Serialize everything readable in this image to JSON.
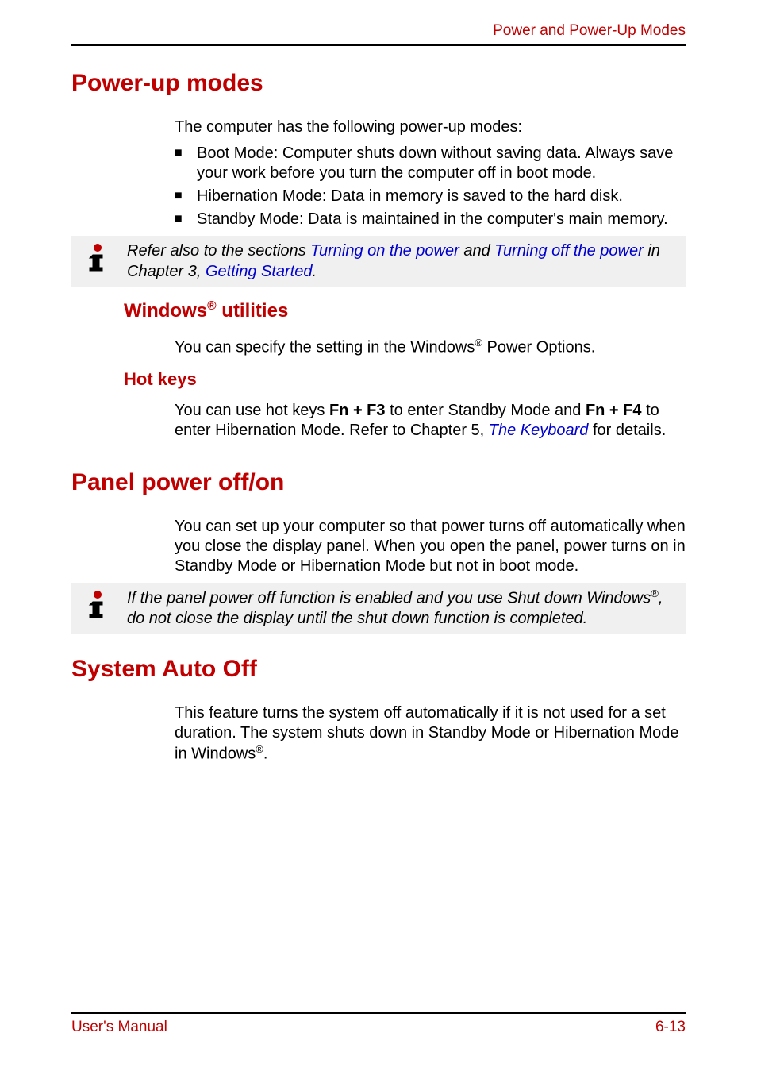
{
  "header": {
    "section_title": "Power and Power-Up Modes"
  },
  "s1": {
    "heading": "Power-up modes",
    "intro": "The computer has the following power-up modes:",
    "bullets": [
      "Boot Mode: Computer shuts down without saving data. Always save your work before you turn the computer off in boot mode.",
      "Hibernation Mode: Data in memory is saved to the hard disk.",
      "Standby Mode: Data is maintained in the computer's main memory."
    ],
    "note": {
      "pre": "Refer also to the sections ",
      "link1": "Turning on the power",
      "mid1": " and ",
      "link2": "Turning off the power",
      "mid2": " in Chapter 3, ",
      "link3": "Getting Started",
      "post": "."
    },
    "sub1": {
      "heading_pre": "Windows",
      "heading_sup": "®",
      "heading_post": " utilities",
      "body_pre": "You can specify the setting in the Windows",
      "body_sup": "®",
      "body_post": " Power Options."
    },
    "sub2": {
      "heading": "Hot keys",
      "body_pre": "You can use hot keys ",
      "key1": "Fn + F3",
      "mid1": " to enter Standby Mode and ",
      "key2": "Fn + F4",
      "mid2": " to enter Hibernation Mode. Refer to Chapter 5, ",
      "link": "The Keyboard",
      "post": " for details."
    }
  },
  "s2": {
    "heading": "Panel power off/on",
    "body": "You can set up your computer so that power turns off automatically when you close the display panel. When you open the panel, power turns on in Standby Mode or Hibernation Mode but not in boot mode.",
    "note": {
      "pre": "If the panel power off function is enabled and you use Shut down Windows",
      "sup": "®",
      "post": ", do not close the display until the shut down function is completed."
    }
  },
  "s3": {
    "heading": "System Auto Off",
    "body_pre": "This feature turns the system off automatically if it is not used for a set duration. The system shuts down in Standby Mode or Hibernation Mode in Windows",
    "body_sup": "®",
    "body_post": "."
  },
  "footer": {
    "left": "User's Manual",
    "right": "6-13"
  }
}
